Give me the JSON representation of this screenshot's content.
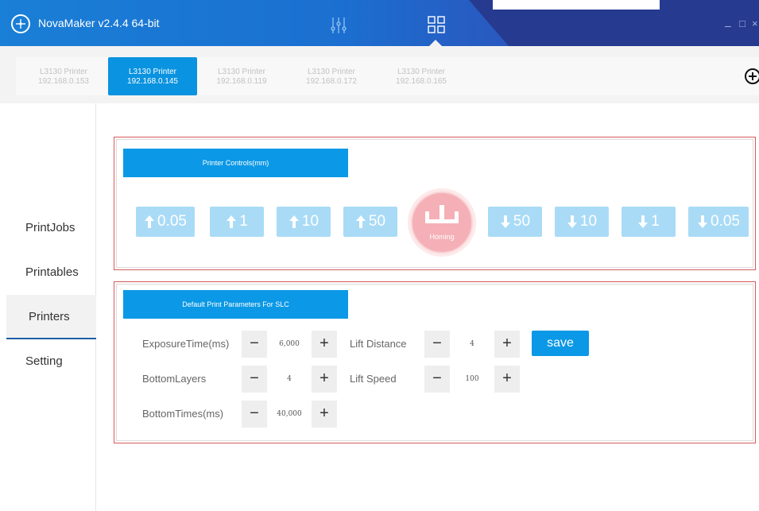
{
  "app": {
    "title": "NovaMaker v2.4.4 64-bit",
    "window_controls": {
      "minimize": "–",
      "maximize": "□",
      "close": "×"
    }
  },
  "printer_tabs": [
    {
      "name": "L3130 Printer",
      "ip": "192.168.0.153",
      "active": false
    },
    {
      "name": "L3130 Printer",
      "ip": "192.168.0.145",
      "active": true
    },
    {
      "name": "L3130 Printer",
      "ip": "192.168.0.119",
      "active": false
    },
    {
      "name": "L3130 Printer",
      "ip": "192.168.0.172",
      "active": false
    },
    {
      "name": "L3130 Printer",
      "ip": "192.168.0.165",
      "active": false
    }
  ],
  "sidebar": {
    "items": [
      {
        "label": "PrintJobs",
        "active": false
      },
      {
        "label": "Printables",
        "active": false
      },
      {
        "label": "Printers",
        "active": true
      },
      {
        "label": "Setting",
        "active": false
      }
    ]
  },
  "controls": {
    "header": "Printer Controls(mm)",
    "up_buttons": [
      "0.05",
      "1",
      "10",
      "50"
    ],
    "homing_label": "Homing",
    "down_buttons": [
      "50",
      "10",
      "1",
      "0.05"
    ]
  },
  "params": {
    "header": "Default Print Parameters For SLC",
    "exposure_label": "ExposureTime(ms)",
    "exposure_value": "6,000",
    "bottom_layers_label": "BottomLayers",
    "bottom_layers_value": "4",
    "bottom_times_label": "BottomTimes(ms)",
    "bottom_times_value": "40,000",
    "lift_distance_label": "Lift Distance",
    "lift_distance_value": "4",
    "lift_speed_label": "Lift Speed",
    "lift_speed_value": "100",
    "save_label": "save",
    "minus": "−",
    "plus": "+"
  },
  "colors": {
    "accent": "#0b98e6",
    "move_button": "#a9dbf6",
    "homing": "#f4b0b6",
    "panel_border": "#d65a5a"
  }
}
